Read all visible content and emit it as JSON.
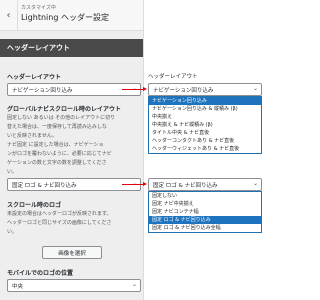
{
  "header": {
    "subtitle": "カスタマイズ中",
    "title": "Lightning ヘッダー設定",
    "back_icon": "chevron-left-icon"
  },
  "section_title": "ヘッダーレイアウト",
  "header_layout": {
    "label": "ヘッダーレイアウト",
    "value": "ナビゲーション回り込み"
  },
  "global_nav": {
    "label": "グローバルナビスクロール時のレイアウト",
    "desc": [
      "固定しない あるいは その他のレイアウトに切り",
      "替えた場合は、一度保存して再読み込みしな",
      "いと反映されません。",
      "ナビ固定 に設定した場合は、ナビゲーショ",
      "ンがロゴを覆わないように、必要に応じてナビ",
      "ゲーションの数と文字の数を調整してくださ",
      "い。"
    ],
    "value": "固定 ロゴ & ナビ回り込み"
  },
  "scroll_logo": {
    "label": "スクロール時のロゴ",
    "desc": [
      "未設定の場合はヘッダーロゴが反映されます。",
      "ヘッダーロゴと同じサイズの画像にしてくださ",
      "い。"
    ],
    "button": "画像を選択"
  },
  "mobile_logo": {
    "label": "モバイルでのロゴの位置",
    "value": "中央"
  },
  "right_top": {
    "label": "ヘッダーレイアウト",
    "value": "ナビゲーション回り込み",
    "options": [
      "ナビゲーション回り込み",
      "ナビゲーション回り込み & 縦積み (β)",
      "中央揃え",
      "中央揃え & ナビ縦積み (β)",
      "タイトル中央 & ナビ直後",
      "ヘッダーコンタクトあり & ナビ直後",
      "ヘッダーウィジェットあり & ナビ直後"
    ],
    "selected_index": 0
  },
  "right_bottom": {
    "value": "固定 ロゴ & ナビ回り込み",
    "options": [
      "固定しない",
      "固定 ナビ中央揃え",
      "固定 ナビコンテナ幅",
      "固定 ロゴ & ナビ回り込み",
      "固定 ロゴ & ナビ回り込み全幅"
    ],
    "selected_index": 3
  },
  "colors": {
    "accent": "#e60012",
    "selection": "#1e73be",
    "focus_border": "#2271b1"
  }
}
